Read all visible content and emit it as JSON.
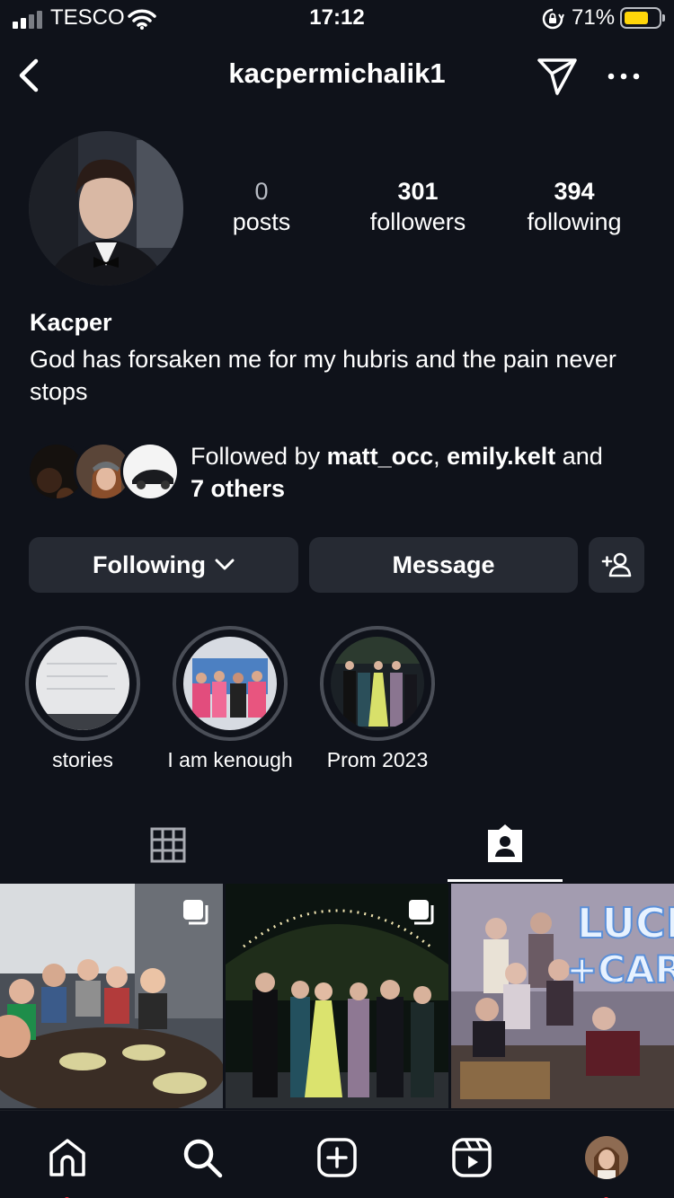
{
  "status_bar": {
    "carrier": "TESCO",
    "time": "17:12",
    "battery": "71%",
    "battery_level": 0.71
  },
  "header": {
    "username": "kacpermichalik1"
  },
  "profile": {
    "stats": [
      {
        "value": "0",
        "label": "posts"
      },
      {
        "value": "301",
        "label": "followers"
      },
      {
        "value": "394",
        "label": "following"
      }
    ],
    "name": "Kacper",
    "bio": "God has forsaken me for my hubris and the pain never stops"
  },
  "mutual": {
    "prefix": "Followed by ",
    "user1": "matt_occ",
    "sep": ", ",
    "user2": "emily.kelt",
    "conj": " and",
    "others": "7 others"
  },
  "actions": {
    "following_label": "Following",
    "message_label": "Message"
  },
  "highlights": [
    {
      "label": "stories"
    },
    {
      "label": "I am kenough"
    },
    {
      "label": "Prom 2023"
    }
  ],
  "tabs": {
    "active": "tagged"
  },
  "icons": [
    "signal-icon",
    "wifi-icon",
    "rotation-lock-icon",
    "battery-icon",
    "back-icon",
    "send-icon",
    "more-icon",
    "chevron-down-icon",
    "add-user-icon",
    "grid-icon",
    "tagged-icon",
    "carousel-icon",
    "home-icon",
    "search-icon",
    "create-icon",
    "reels-icon"
  ],
  "colors": {
    "background": "#0f121a",
    "button": "#262a33",
    "notification_dot": "#ff3040",
    "battery": "#ffd60a"
  }
}
